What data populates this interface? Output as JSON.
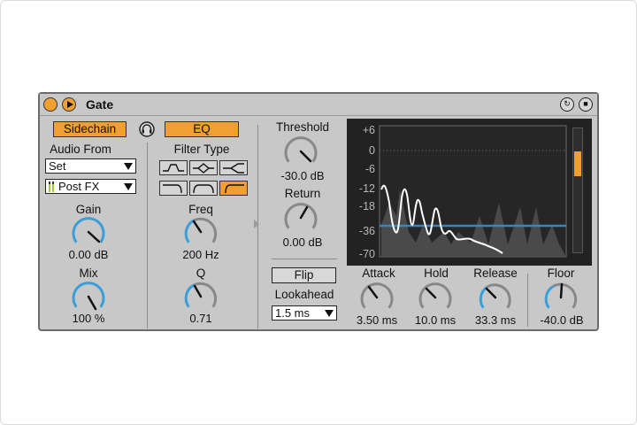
{
  "device": {
    "title": "Gate",
    "icons": [
      "power-icon",
      "play-icon",
      "reset-icon",
      "save-icon"
    ]
  },
  "sidechain": {
    "button_label": "Sidechain",
    "headphones_icon": "headphones-icon",
    "audio_from_label": "Audio From",
    "audio_from_value": "Set",
    "position_value": "Post FX",
    "gain": {
      "label": "Gain",
      "value": "0.00 dB"
    },
    "mix": {
      "label": "Mix",
      "value": "100 %"
    }
  },
  "eq": {
    "button_label": "EQ",
    "filter_type_label": "Filter Type",
    "filter_types": [
      "bandpass",
      "peak",
      "notch",
      "lowpass",
      "bell",
      "highpass"
    ],
    "selected_filter_index": 5,
    "freq": {
      "label": "Freq",
      "value": "200 Hz"
    },
    "q": {
      "label": "Q",
      "value": "0.71"
    }
  },
  "gate": {
    "threshold": {
      "label": "Threshold",
      "value": "-30.0 dB"
    },
    "return": {
      "label": "Return",
      "value": "0.00 dB"
    },
    "flip_label": "Flip",
    "lookahead": {
      "label": "Lookahead",
      "value": "1.5 ms"
    },
    "attack": {
      "label": "Attack",
      "value": "3.50 ms"
    },
    "hold": {
      "label": "Hold",
      "value": "10.0 ms"
    },
    "release": {
      "label": "Release",
      "value": "33.3 ms"
    },
    "floor": {
      "label": "Floor",
      "value": "-40.0 dB"
    }
  },
  "display": {
    "db_labels": [
      "+6",
      "0",
      "-6",
      "-12",
      "-18",
      "-36",
      "-70"
    ],
    "threshold_line_color": "#2f86c8",
    "waveform_color": "#ffffff",
    "meter_level_fraction": 0.2
  },
  "colors": {
    "accent": "#f0a030",
    "knob_arc": "#3a9fd8",
    "panel": "#c8c8c8"
  }
}
